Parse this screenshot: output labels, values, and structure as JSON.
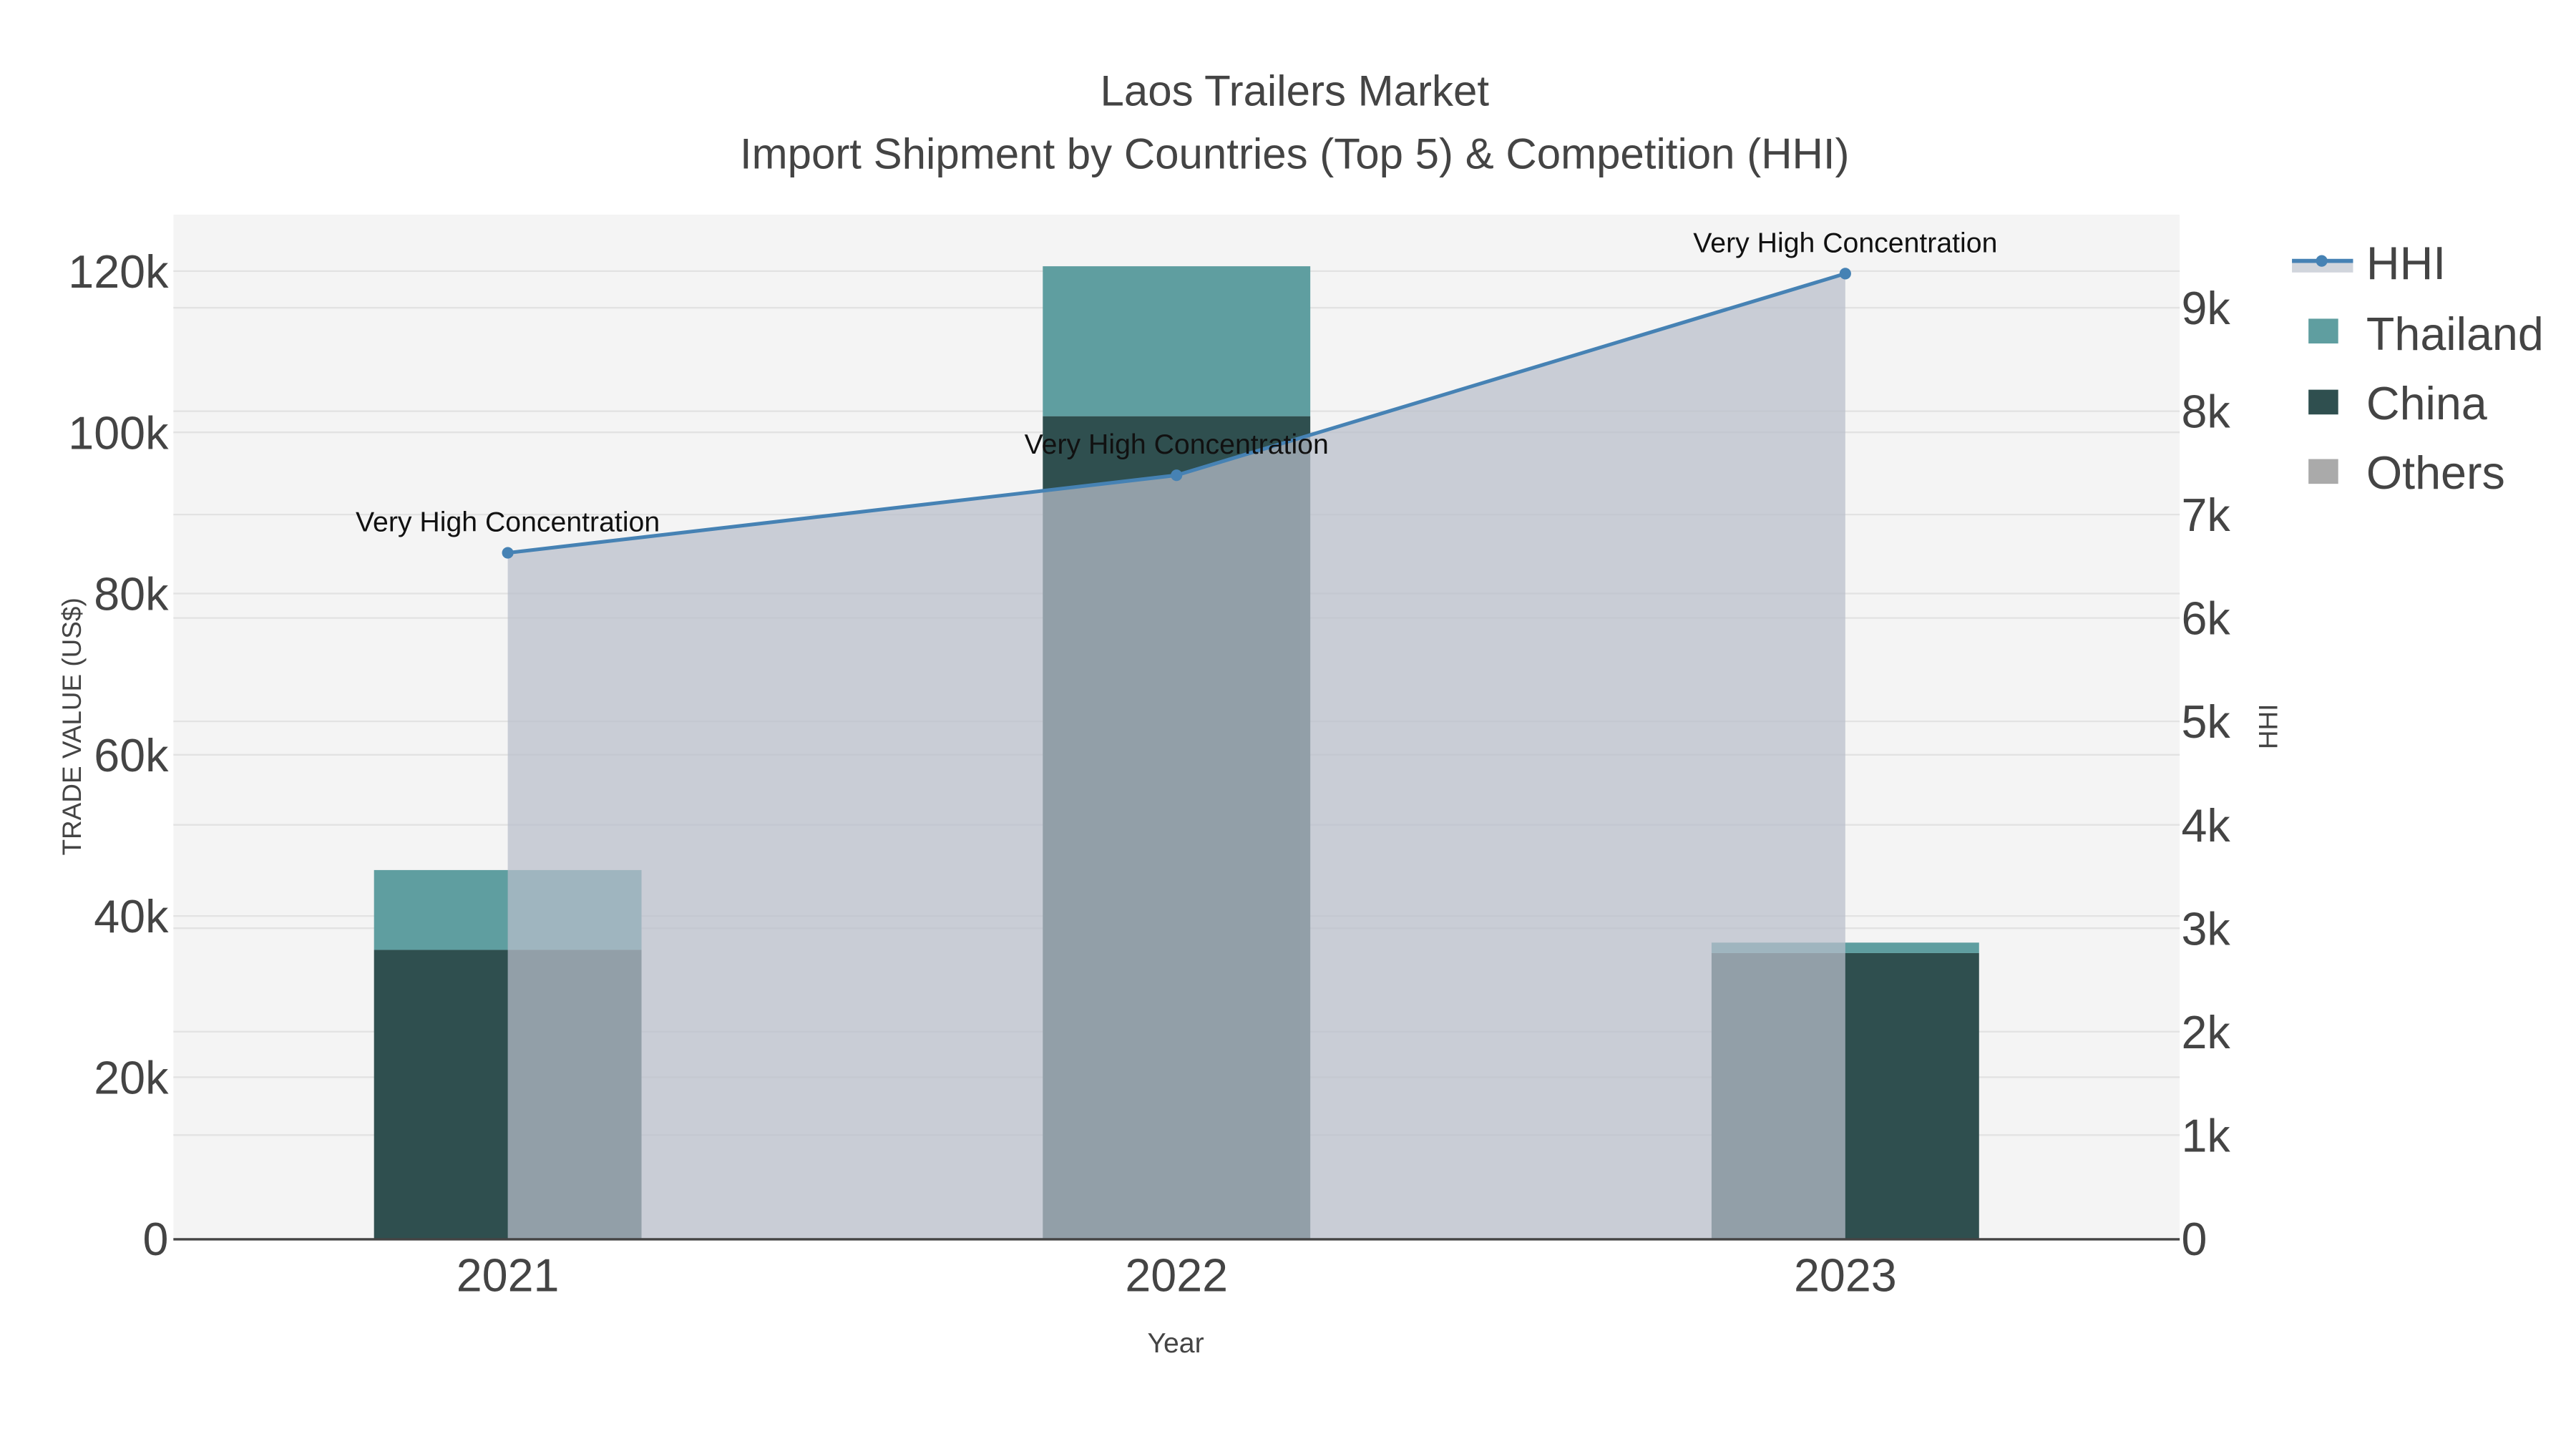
{
  "chart_data": {
    "type": "bar",
    "title": "Laos Trailers Market",
    "subtitle": "Import Shipment by Countries (Top 5) & Competition (HHI)",
    "xlabel": "Year",
    "ylabel": "TRADE VALUE (US$)",
    "y2label": "HHI",
    "categories": [
      "2021",
      "2022",
      "2023"
    ],
    "ylim": [
      0,
      127000
    ],
    "y2lim": [
      0,
      9900
    ],
    "yticks": [
      0,
      20000,
      40000,
      60000,
      80000,
      100000,
      120000
    ],
    "ytick_labels": [
      "0",
      "20k",
      "40k",
      "60k",
      "80k",
      "100k",
      "120k"
    ],
    "y2ticks": [
      0,
      1000,
      2000,
      3000,
      4000,
      5000,
      6000,
      7000,
      8000,
      9000
    ],
    "y2tick_labels": [
      "0",
      "1k",
      "2k",
      "3k",
      "4k",
      "5k",
      "6k",
      "7k",
      "8k",
      "9k"
    ],
    "series": [
      {
        "name": "China",
        "type": "bar",
        "color": "#2f4f4f",
        "values": [
          35800,
          102000,
          35400
        ]
      },
      {
        "name": "Thailand",
        "type": "bar",
        "color": "#5f9ea0",
        "values": [
          9900,
          18600,
          1300
        ]
      },
      {
        "name": "Others",
        "type": "bar",
        "color": "#aaaaaa",
        "values": [
          0,
          0,
          0
        ]
      },
      {
        "name": "HHI",
        "type": "line",
        "axis": "y2",
        "color": "#4682b4",
        "values": [
          6630,
          7380,
          9330
        ],
        "annotations": [
          "Very High Concentration",
          "Very High Concentration",
          "Very High Concentration"
        ]
      }
    ],
    "legend": {
      "position": "top-right",
      "items": [
        "HHI",
        "Thailand",
        "China",
        "Others"
      ]
    },
    "grid": true
  }
}
